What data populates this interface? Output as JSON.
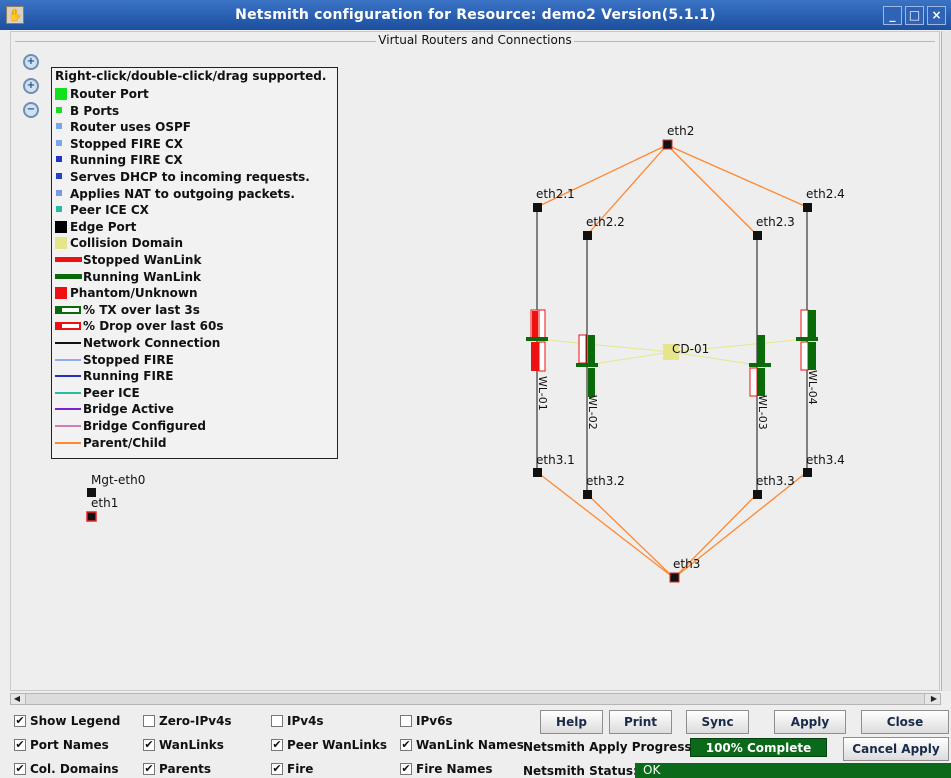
{
  "window": {
    "title": "Netsmith configuration for Resource:  demo2  Version(5.1.1)",
    "minimize": "_",
    "maximize": "□",
    "close": "×"
  },
  "canvas": {
    "title": "Virtual Routers and Connections",
    "zoom": [
      "+",
      "+",
      "−"
    ]
  },
  "legend": {
    "header": "Right-click/double-click/drag supported.",
    "items": [
      {
        "label": "Router Port",
        "color": "#14e11e",
        "kind": "square"
      },
      {
        "label": "B Ports",
        "color": "#14e11e",
        "kind": "small"
      },
      {
        "label": "Router uses OSPF",
        "color": "#7aa6f0",
        "kind": "small"
      },
      {
        "label": "Stopped FIRE CX",
        "color": "#7aa6f0",
        "kind": "small"
      },
      {
        "label": "Running FIRE CX",
        "color": "#2233cc",
        "kind": "small"
      },
      {
        "label": "Serves DHCP to incoming requests.",
        "color": "#2244cc",
        "kind": "small"
      },
      {
        "label": "Applies NAT to outgoing packets.",
        "color": "#7a9ae8",
        "kind": "small"
      },
      {
        "label": "Peer ICE CX",
        "color": "#22c0a0",
        "kind": "small"
      },
      {
        "label": "Edge Port",
        "color": "#000000",
        "kind": "square"
      },
      {
        "label": "Collision Domain",
        "color": "#e5e58a",
        "kind": "square"
      },
      {
        "label": "Stopped WanLink",
        "color": "#ee1111",
        "kind": "bar"
      },
      {
        "label": "Running WanLink",
        "color": "#0a6a0a",
        "kind": "bar"
      },
      {
        "label": "Phantom/Unknown",
        "color": "#ee1111",
        "kind": "square"
      },
      {
        "label": "% TX over last 3s",
        "color": "#0a6a0a",
        "kind": "hollow"
      },
      {
        "label": "% Drop over last 60s",
        "color": "#ee1111",
        "kind": "hollow"
      },
      {
        "label": "Network Connection",
        "color": "#111111",
        "kind": "line"
      },
      {
        "label": "Stopped FIRE",
        "color": "#8fb0ee",
        "kind": "line"
      },
      {
        "label": "Running FIRE",
        "color": "#2233bb",
        "kind": "line"
      },
      {
        "label": "Peer ICE",
        "color": "#22c0a0",
        "kind": "line"
      },
      {
        "label": "Bridge Active",
        "color": "#7a22cc",
        "kind": "line"
      },
      {
        "label": "Bridge Configured",
        "color": "#d080b0",
        "kind": "line"
      },
      {
        "label": "Parent/Child",
        "color": "#ff8833",
        "kind": "line"
      }
    ]
  },
  "graph": {
    "mgt_port": "Mgt-eth0",
    "eth1_port": "eth1",
    "ports": [
      "eth2",
      "eth2.1",
      "eth2.2",
      "eth2.3",
      "eth2.4",
      "eth3.1",
      "eth3.2",
      "eth3.3",
      "eth3.4",
      "eth3"
    ],
    "collision_domain": "CD-01",
    "wanlinks": [
      "WL-01",
      "WL-02",
      "WL-03",
      "WL-04"
    ]
  },
  "checkboxes": [
    {
      "label": "Show Legend",
      "checked": "✔"
    },
    {
      "label": "Zero-IPv4s",
      "checked": ""
    },
    {
      "label": "IPv4s",
      "checked": ""
    },
    {
      "label": "IPv6s",
      "checked": ""
    },
    {
      "label": "Port Names",
      "checked": "✔"
    },
    {
      "label": "WanLinks",
      "checked": "✔"
    },
    {
      "label": "Peer WanLinks",
      "checked": "✔"
    },
    {
      "label": "WanLink Names",
      "checked": "✔"
    },
    {
      "label": "Col. Domains",
      "checked": "✔"
    },
    {
      "label": "Parents",
      "checked": "✔"
    },
    {
      "label": "Fire",
      "checked": "✔"
    },
    {
      "label": "Fire Names",
      "checked": "✔"
    }
  ],
  "buttons": {
    "help": "Help",
    "print": "Print",
    "sync": "Sync",
    "apply": "Apply",
    "close": "Close",
    "cancel_apply": "Cancel Apply"
  },
  "status": {
    "progress_label": "Netsmith Apply Progress:",
    "progress_value": "100% Complete",
    "status_label": "Netsmith Status:",
    "status_value": "OK"
  }
}
